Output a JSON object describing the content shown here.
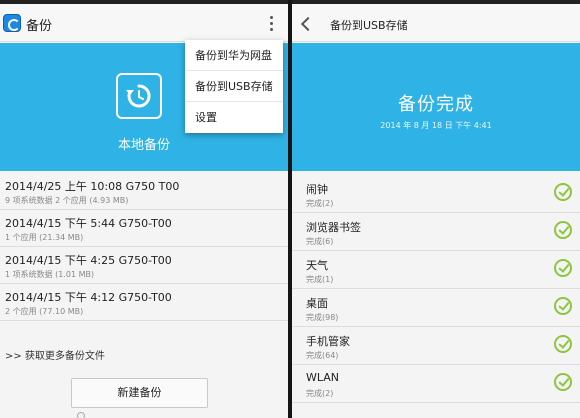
{
  "left": {
    "appbar": {
      "title": "备份"
    },
    "menu": {
      "items": [
        "备份到华为网盘",
        "备份到USB存储",
        "设置"
      ]
    },
    "hero": {
      "label": "本地备份"
    },
    "records": [
      {
        "title": "2014/4/25 上午 10:08 G750 T00",
        "detail": "9 项系统数据 2 个应用 (4.93 MB)"
      },
      {
        "title": "2014/4/15 下午 5:44 G750-T00",
        "detail": "1 个应用 (21.34 MB)"
      },
      {
        "title": "2014/4/15 下午 4:25 G750-T00",
        "detail": "1 项系统数据 (1.01 MB)"
      },
      {
        "title": "2014/4/15 下午 4:12 G750-T00",
        "detail": "2 个应用 (77.10 MB)"
      }
    ],
    "more_link": ">> 获取更多备份文件",
    "new_backup_button": "新建备份"
  },
  "right": {
    "appbar": {
      "title": "备份到USB存储"
    },
    "hero": {
      "title": "备份完成",
      "date": "2014 年 8 月 18 日 下午 4:41"
    },
    "items": [
      {
        "name": "闹钟",
        "status": "完成(2)"
      },
      {
        "name": "浏览器书签",
        "status": "完成(6)"
      },
      {
        "name": "天气",
        "status": "完成(1)"
      },
      {
        "name": "桌面",
        "status": "完成(98)"
      },
      {
        "name": "手机管家",
        "status": "完成(64)"
      },
      {
        "name": "WLAN",
        "status": "完成(2)"
      }
    ]
  },
  "colors": {
    "accent_blue": "#2fb3e6",
    "check_green": "#8cc63f"
  },
  "icons": {
    "app": "backup-app-icon",
    "hero": "restore-icon",
    "menu": "overflow-menu-icon",
    "back": "back-arrow-icon",
    "check": "check-circle-icon"
  }
}
